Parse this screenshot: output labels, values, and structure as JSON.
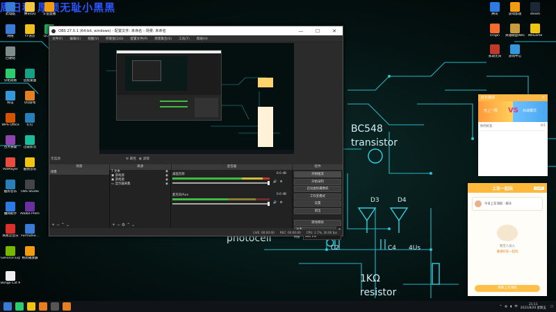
{
  "wallpaper": {
    "watermark": "周日秩 厚颜无耻小黑黑",
    "circuit_labels": {
      "transistor_part": "BC548",
      "transistor_word": "transistor",
      "photocell": "photocell",
      "resistor_value": "1KΩ",
      "resistor_word": "resistor",
      "c2": "C2",
      "c4": "C4",
      "d3": "D3",
      "d4": "D4",
      "four_us": "4Us"
    }
  },
  "desktop_icons_left": [
    {
      "label": "此电脑",
      "color": "#3a7bd5"
    },
    {
      "label": "腾讯QQ",
      "color": "#f2c744"
    },
    {
      "label": "斗鱼直播",
      "color": "#f39c12"
    },
    {
      "label": "网络",
      "color": "#3a7bd5"
    },
    {
      "label": "YY语音",
      "color": "#f0c020"
    },
    {
      "label": "QQ音乐",
      "color": "#27ae60"
    },
    {
      "label": "回收站",
      "color": "#7f8c8d"
    },
    {
      "label": "分组观看",
      "color": "#2ecc71"
    },
    {
      "label": "远程桌面",
      "color": "#16a085"
    },
    {
      "label": "好压",
      "color": "#3498db"
    },
    {
      "label": "QQ游戏",
      "color": "#e67e22"
    },
    {
      "label": "WPS Office",
      "color": "#d35400"
    },
    {
      "label": "钉钉",
      "color": "#2980b9"
    },
    {
      "label": "百大悬疑",
      "color": "#8e44ad"
    },
    {
      "label": "迅雷影音",
      "color": "#1abc9c"
    },
    {
      "label": "PotPlayer",
      "color": "#e74c3c"
    },
    {
      "label": "酷我音乐",
      "color": "#f1c40f"
    },
    {
      "label": "酷狗音乐",
      "color": "#2980b9"
    },
    {
      "label": "OBS Studio",
      "color": "#444444"
    },
    {
      "label": "魔网助手",
      "color": "#2c7be5"
    },
    {
      "label": "Adobe Premie...",
      "color": "#6b2fa0"
    },
    {
      "label": "网易云音乐",
      "color": "#d9302b"
    },
    {
      "label": "FormatFa...",
      "color": "#3a7bd5"
    },
    {
      "label": "GeForce Experience",
      "color": "#76b900"
    },
    {
      "label": "格式播放器",
      "color": "#f39c12"
    },
    {
      "label": "Bongo Cat Mver.exe",
      "color": "#eeeeee"
    }
  ],
  "desktop_icons_right": [
    {
      "label": "腾讯",
      "color": "#2c7be5"
    },
    {
      "label": "游戏加速",
      "color": "#f39c12"
    },
    {
      "label": "steam",
      "color": "#1b2838"
    },
    {
      "label": "Origin",
      "color": "#f56c2d"
    },
    {
      "label": "英雄联盟WeGame版",
      "color": "#c89b3c"
    },
    {
      "label": "WeGame",
      "color": "#f1c40f"
    },
    {
      "label": "永劫无间",
      "color": "#c0392b"
    },
    {
      "label": "游戏中心",
      "color": "#3498db"
    }
  ],
  "obs": {
    "title": "OBS 27.0.1 (64-bit, windows) - 配置文件: 未命名 - 场景: 未命名",
    "menu": [
      "文件(F)",
      "编辑(E)",
      "视图(V)",
      "停靠窗口(D)",
      "配置文件(P)",
      "场景集合(S)",
      "工具(T)",
      "帮助(H)"
    ],
    "window_controls": [
      "—",
      "☐",
      "✕"
    ],
    "preview_status": "无选源",
    "preview_buttons": [
      "属性",
      "滤镜"
    ],
    "docks": [
      "场景",
      "来源",
      "混音器",
      "转场",
      "控件"
    ],
    "scenes": [
      "场景"
    ],
    "sources": [
      "文本",
      "游戏源",
      "游戏源",
      "显示器采集"
    ],
    "mixer": [
      {
        "name": "桌面音频",
        "db": "0.0 dB"
      },
      {
        "name": "麦克风/Aux",
        "db": "0.0 dB"
      }
    ],
    "transition": {
      "type": "淡出",
      "duration_label": "时长",
      "duration": "300 ms"
    },
    "controls": [
      "开始推流",
      "开始录制",
      "启动虚拟摄像机",
      "工作室模式",
      "设置",
      "退出"
    ],
    "controls_extra": "转场特效",
    "status_bar": [
      "LIVE: 00:00:00",
      "REC: 00:00:00",
      "CPU: 1.7%, 30.00 fps"
    ]
  },
  "popup_right_top": {
    "header": "好友邀请",
    "left_tag": "无上一局",
    "vs": "VS",
    "right_tag": "对战模式",
    "line1": "你的好友",
    "line2": "0/1"
  },
  "popup_right_bottom": {
    "title": "上车一起玩",
    "badge": "CHAT",
    "row_text": "今日上车领取 · 聊天",
    "empty_hint1": "暂无人加入",
    "empty_hint2": "邀请好友一起玩",
    "cta": "我要上车领取"
  },
  "taskbar": {
    "time": "21:11",
    "date": "2021/8/20 星期五",
    "lang": "中",
    "apps": [
      {
        "label": "windows",
        "color": "#3a7bd5"
      },
      {
        "label": "browser",
        "color": "#2ecc71"
      },
      {
        "label": "folder",
        "color": "#f1c40f"
      },
      {
        "label": "app",
        "color": "#e67e22"
      },
      {
        "label": "obs",
        "color": "#555555"
      },
      {
        "label": "app2",
        "color": "#e67e22"
      }
    ]
  }
}
